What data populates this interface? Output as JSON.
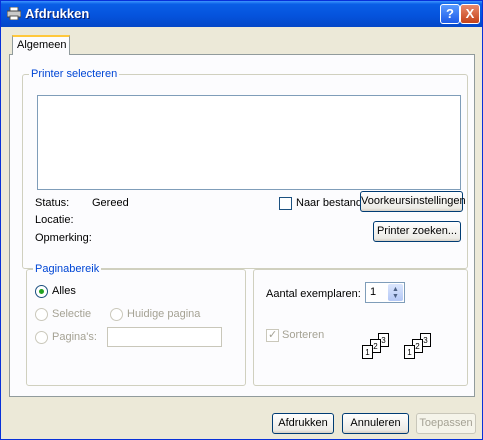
{
  "window": {
    "title": "Afdrukken",
    "help_label": "?",
    "close_label": "X"
  },
  "tabs": [
    {
      "label": "Algemeen"
    }
  ],
  "printer_group": {
    "legend": "Printer selecteren",
    "status_label": "Status:",
    "status_value": "Gereed",
    "location_label": "Locatie:",
    "comment_label": "Opmerking:",
    "to_file_label": "Naar bestand",
    "preferences_button": "Voorkeursinstellingen",
    "find_printer_button": "Printer zoeken..."
  },
  "range_group": {
    "legend": "Paginabereik",
    "all_label": "Alles",
    "selection_label": "Selectie",
    "current_page_label": "Huidige pagina",
    "pages_label": "Pagina's:",
    "pages_value": ""
  },
  "copies_group": {
    "copies_label": "Aantal exemplaren:",
    "copies_value": "1",
    "collate_label": "Sorteren",
    "collate_pages": [
      "1",
      "2",
      "3"
    ]
  },
  "footer": {
    "print_button": "Afdrukken",
    "cancel_button": "Annuleren",
    "apply_button": "Toepassen"
  },
  "icons": {
    "title": "printer-icon",
    "help": "help-icon",
    "close": "close-icon",
    "spin": "spinner-arrows-icon",
    "collate": "collate-pages-icon"
  },
  "colors": {
    "titlebar": "#0553dd",
    "legend_text": "#0046d5",
    "dialog_bg": "#ece9d8",
    "radio_dot": "#21a121",
    "tab_highlight": "#ffc83c"
  }
}
